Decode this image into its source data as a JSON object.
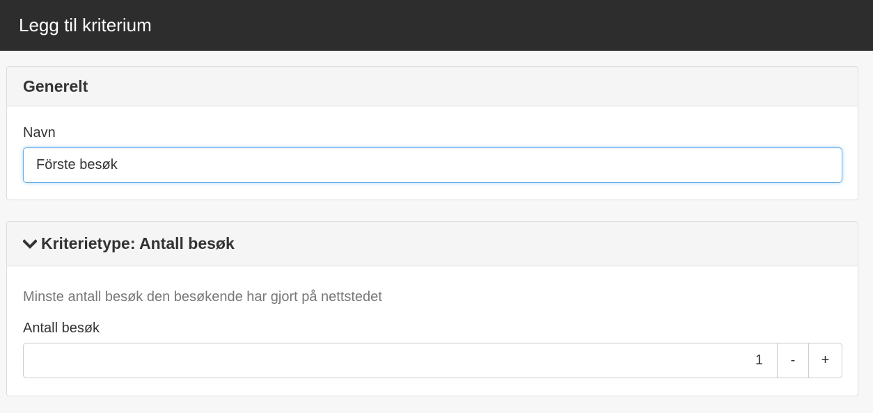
{
  "header": {
    "title": "Legg til kriterium"
  },
  "general_panel": {
    "heading": "Generelt",
    "name_label": "Navn",
    "name_value": "Förste besøk"
  },
  "criteria_panel": {
    "toggle_icon": "chevron-down-icon",
    "heading": "Kriterietype: Antall besøk",
    "description": "Minste antall besøk den besøkende har gjort på nettstedet",
    "visits_label": "Antall besøk",
    "visits_value": "1",
    "decrement_label": "-",
    "increment_label": "+"
  }
}
